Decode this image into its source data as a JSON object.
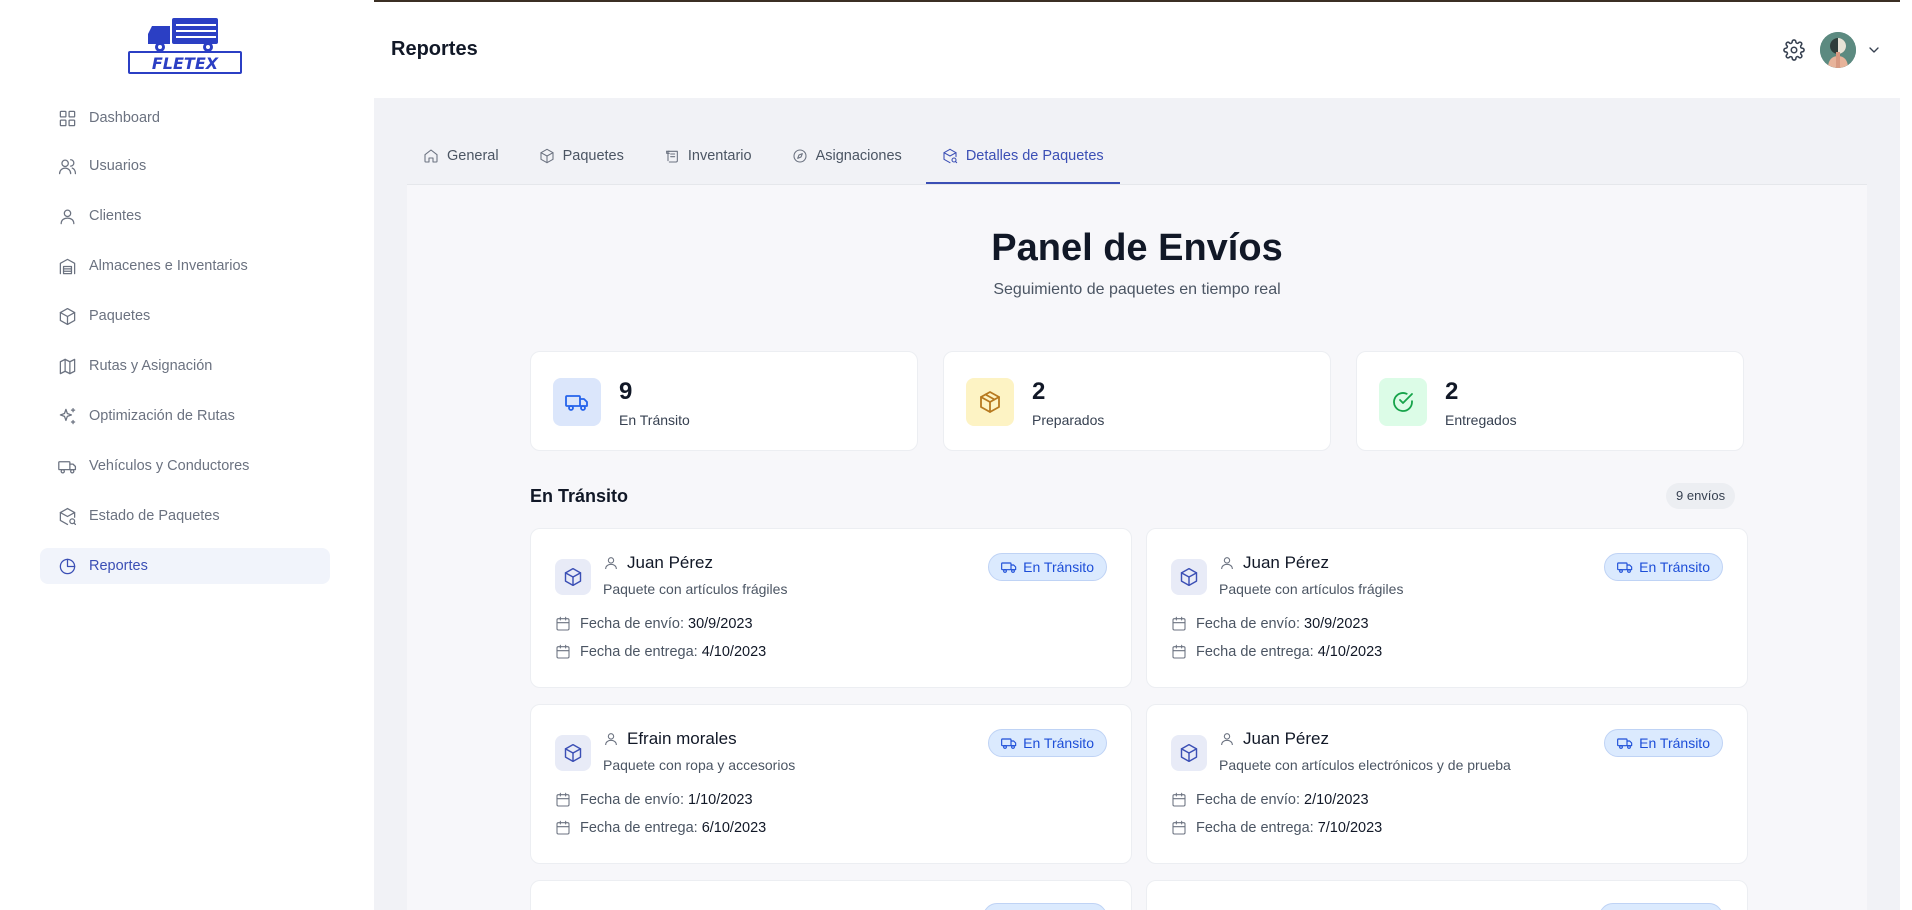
{
  "app": {
    "logo_text": "FLETEX"
  },
  "sidebar": {
    "items": [
      {
        "label": "Dashboard",
        "icon": "grid-icon"
      },
      {
        "label": "Usuarios",
        "icon": "users-icon"
      },
      {
        "label": "Clientes",
        "icon": "user-icon"
      },
      {
        "label": "Almacenes e Inventarios",
        "icon": "warehouse-icon"
      },
      {
        "label": "Paquetes",
        "icon": "package-icon"
      },
      {
        "label": "Rutas y Asignación",
        "icon": "map-icon"
      },
      {
        "label": "Optimización de Rutas",
        "icon": "sparkles-icon"
      },
      {
        "label": "Vehículos y Conductores",
        "icon": "truck-icon"
      },
      {
        "label": "Estado de Paquetes",
        "icon": "package-search-icon"
      },
      {
        "label": "Reportes",
        "icon": "pie-chart-icon",
        "active": true
      }
    ]
  },
  "header": {
    "title": "Reportes"
  },
  "tabs": [
    {
      "label": "General",
      "icon": "home-icon"
    },
    {
      "label": "Paquetes",
      "icon": "package-icon"
    },
    {
      "label": "Inventario",
      "icon": "scroll-icon"
    },
    {
      "label": "Asignaciones",
      "icon": "compass-icon"
    },
    {
      "label": "Detalles de Paquetes",
      "icon": "package-search-icon",
      "active": true
    }
  ],
  "panel": {
    "title": "Panel de Envíos",
    "subtitle": "Seguimiento de paquetes en tiempo real"
  },
  "stats": [
    {
      "value": "9",
      "label": "En Tránsito",
      "icon": "truck-icon",
      "bg": "#dbe6fb",
      "color": "#2563eb"
    },
    {
      "value": "2",
      "label": "Preparados",
      "icon": "package-icon",
      "bg": "#fdf3c4",
      "color": "#b7791f"
    },
    {
      "value": "2",
      "label": "Entregados",
      "icon": "check-circle-icon",
      "bg": "#dcfce7",
      "color": "#16a34a"
    }
  ],
  "section": {
    "title": "En Tránsito",
    "count": "9 envíos"
  },
  "labels": {
    "shipped": "Fecha de envío:",
    "delivery": "Fecha de entrega:"
  },
  "shipments": [
    {
      "name": "Juan Pérez",
      "desc": "Paquete con artículos frágiles",
      "status": "En Tránsito",
      "shipped": "30/9/2023",
      "delivery": "4/10/2023"
    },
    {
      "name": "Juan Pérez",
      "desc": "Paquete con artículos frágiles",
      "status": "En Tránsito",
      "shipped": "30/9/2023",
      "delivery": "4/10/2023"
    },
    {
      "name": "Efrain morales",
      "desc": "Paquete con ropa y accesorios",
      "status": "En Tránsito",
      "shipped": "1/10/2023",
      "delivery": "6/10/2023"
    },
    {
      "name": "Juan Pérez",
      "desc": "Paquete con artículos electrónicos y de prueba",
      "status": "En Tránsito",
      "shipped": "2/10/2023",
      "delivery": "7/10/2023"
    }
  ],
  "colors": {
    "accent": "#3b4fb5",
    "status_blue": "#1d4ed8"
  }
}
